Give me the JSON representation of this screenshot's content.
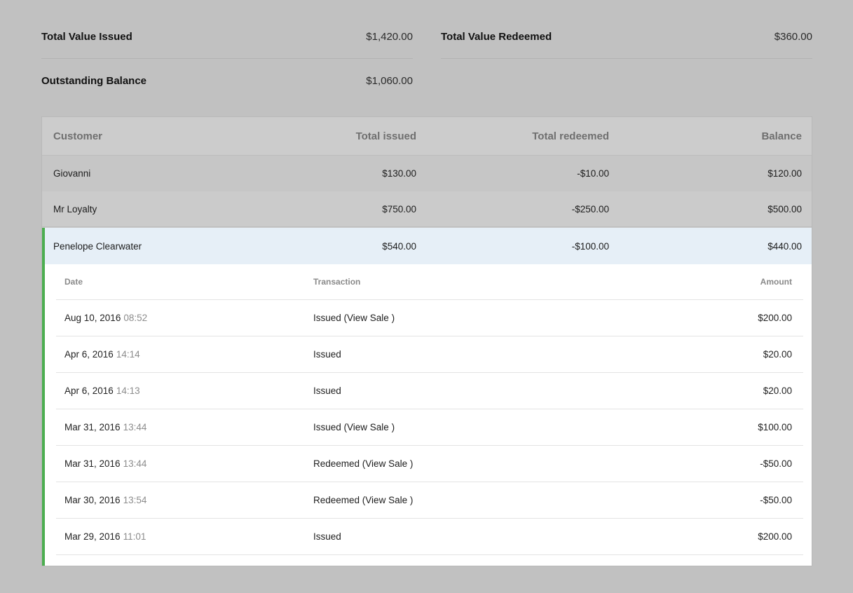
{
  "summary": {
    "total_issued_label": "Total Value Issued",
    "total_issued_value": "$1,420.00",
    "total_redeemed_label": "Total Value Redeemed",
    "total_redeemed_value": "$360.00",
    "outstanding_label": "Outstanding Balance",
    "outstanding_value": "$1,060.00"
  },
  "table": {
    "headers": {
      "customer": "Customer",
      "total_issued": "Total issued",
      "total_redeemed": "Total redeemed",
      "balance": "Balance"
    },
    "rows": [
      {
        "customer": "Giovanni",
        "issued": "$130.00",
        "redeemed": "-$10.00",
        "balance": "$120.00"
      },
      {
        "customer": "Mr Loyalty",
        "issued": "$750.00",
        "redeemed": "-$250.00",
        "balance": "$500.00"
      },
      {
        "customer": "Penelope Clearwater",
        "issued": "$540.00",
        "redeemed": "-$100.00",
        "balance": "$440.00"
      }
    ]
  },
  "detail": {
    "headers": {
      "date": "Date",
      "transaction": "Transaction",
      "amount": "Amount"
    },
    "rows": [
      {
        "date": "Aug 10, 2016",
        "time": "08:52",
        "type": "Issued",
        "view_sale": "View Sale",
        "amount": "$200.00"
      },
      {
        "date": "Apr 6, 2016",
        "time": "14:14",
        "type": "Issued",
        "view_sale": "",
        "amount": "$20.00"
      },
      {
        "date": "Apr 6, 2016",
        "time": "14:13",
        "type": "Issued",
        "view_sale": "",
        "amount": "$20.00"
      },
      {
        "date": "Mar 31, 2016",
        "time": "13:44",
        "type": "Issued",
        "view_sale": "View Sale",
        "amount": "$100.00"
      },
      {
        "date": "Mar 31, 2016",
        "time": "13:44",
        "type": "Redeemed",
        "view_sale": "View Sale",
        "amount": "-$50.00"
      },
      {
        "date": "Mar 30, 2016",
        "time": "13:54",
        "type": "Redeemed",
        "view_sale": "View Sale",
        "amount": "-$50.00"
      },
      {
        "date": "Mar 29, 2016",
        "time": "11:01",
        "type": "Issued",
        "view_sale": "",
        "amount": "$200.00"
      }
    ]
  },
  "colors": {
    "page_bg": "#c1c1c1",
    "selected_row_bg": "#e6eff7",
    "accent_bar": "#4cae50"
  }
}
